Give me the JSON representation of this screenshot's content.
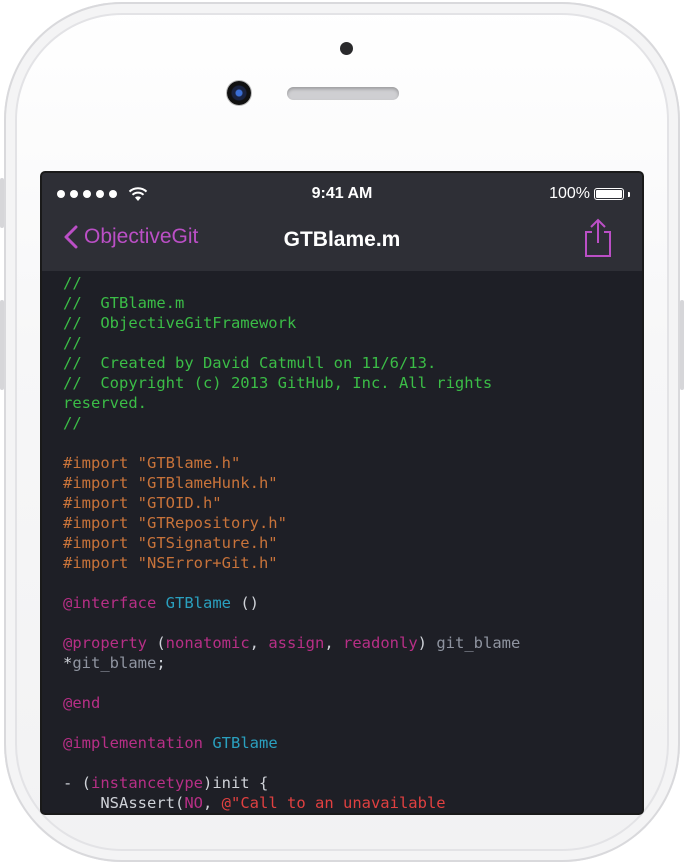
{
  "status_bar": {
    "time": "9:41 AM",
    "battery_percent": "100%",
    "signal_dots": 5
  },
  "nav": {
    "back_label": "ObjectiveGit",
    "title": "GTBlame.m",
    "accent_color": "#bb4fc6"
  },
  "code_lines": [
    [
      {
        "t": "//",
        "c": "comment"
      }
    ],
    [
      {
        "t": "//  GTBlame.m",
        "c": "comment"
      }
    ],
    [
      {
        "t": "//  ObjectiveGitFramework",
        "c": "comment"
      }
    ],
    [
      {
        "t": "//",
        "c": "comment"
      }
    ],
    [
      {
        "t": "//  Created by David Catmull on 11/6/13.",
        "c": "comment"
      }
    ],
    [
      {
        "t": "//  Copyright (c) 2013 GitHub, Inc. All rights",
        "c": "comment"
      }
    ],
    [
      {
        "t": "reserved.",
        "c": "comment"
      }
    ],
    [
      {
        "t": "//",
        "c": "comment"
      }
    ],
    [],
    [
      {
        "t": "#import \"GTBlame.h\"",
        "c": "pre"
      }
    ],
    [
      {
        "t": "#import \"GTBlameHunk.h\"",
        "c": "pre"
      }
    ],
    [
      {
        "t": "#import \"GTOID.h\"",
        "c": "pre"
      }
    ],
    [
      {
        "t": "#import \"GTRepository.h\"",
        "c": "pre"
      }
    ],
    [
      {
        "t": "#import \"GTSignature.h\"",
        "c": "pre"
      }
    ],
    [
      {
        "t": "#import \"NSError+Git.h\"",
        "c": "pre"
      }
    ],
    [],
    [
      {
        "t": "@interface",
        "c": "kw"
      },
      {
        "t": " ",
        "c": "plain"
      },
      {
        "t": "GTBlame",
        "c": "class"
      },
      {
        "t": " ()",
        "c": "plain"
      }
    ],
    [],
    [
      {
        "t": "@property",
        "c": "kw"
      },
      {
        "t": " (",
        "c": "plain"
      },
      {
        "t": "nonatomic",
        "c": "kw"
      },
      {
        "t": ", ",
        "c": "plain"
      },
      {
        "t": "assign",
        "c": "kw"
      },
      {
        "t": ", ",
        "c": "plain"
      },
      {
        "t": "readonly",
        "c": "kw"
      },
      {
        "t": ") ",
        "c": "plain"
      },
      {
        "t": "git_blame",
        "c": "type"
      }
    ],
    [
      {
        "t": "*",
        "c": "plain"
      },
      {
        "t": "git_blame",
        "c": "type"
      },
      {
        "t": ";",
        "c": "plain"
      }
    ],
    [],
    [
      {
        "t": "@end",
        "c": "kw"
      }
    ],
    [],
    [
      {
        "t": "@implementation",
        "c": "kw"
      },
      {
        "t": " ",
        "c": "plain"
      },
      {
        "t": "GTBlame",
        "c": "class"
      }
    ],
    [],
    [
      {
        "t": "- (",
        "c": "plain"
      },
      {
        "t": "instancetype",
        "c": "kw"
      },
      {
        "t": ")init {",
        "c": "plain"
      }
    ],
    [
      {
        "t": "    NSAssert(",
        "c": "plain"
      },
      {
        "t": "NO",
        "c": "kw"
      },
      {
        "t": ", ",
        "c": "plain"
      },
      {
        "t": "@\"Call to an unavailable",
        "c": "red"
      }
    ]
  ]
}
